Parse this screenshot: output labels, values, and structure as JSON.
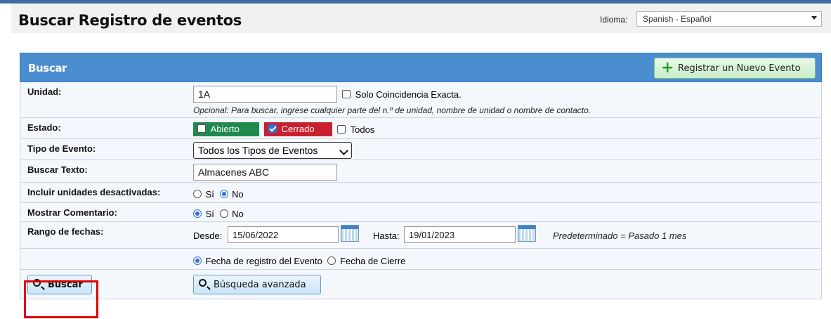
{
  "header": {
    "title": "Buscar Registro de eventos",
    "language_label": "Idioma:",
    "language_value": "Spanish - Español"
  },
  "panel": {
    "title": "Buscar",
    "new_event_button": "Registrar un Nuevo Evento"
  },
  "form": {
    "unit": {
      "label": "Unidad:",
      "value": "1A",
      "exact_match_label": "Solo Coincidencia Exacta.",
      "exact_match_checked": false,
      "hint": "Opcional: Para buscar, ingrese cualquier parte del n.º de unidad, nombre de unidad o nombre de contacto."
    },
    "status": {
      "label": "Estado:",
      "open_label": "Abierto",
      "open_checked": false,
      "closed_label": "Cerrado",
      "closed_checked": true,
      "all_label": "Todos",
      "all_checked": false
    },
    "event_type": {
      "label": "Tipo de Evento:",
      "value": "Todos los Tipos de Eventos"
    },
    "search_text": {
      "label": "Buscar Texto:",
      "value": "Almacenes ABC"
    },
    "include_inactive": {
      "label": "Incluir unidades desactivadas:",
      "yes_label": "Sí",
      "no_label": "No",
      "selected": "No"
    },
    "show_comment": {
      "label": "Mostrar Comentario:",
      "yes_label": "Sí",
      "no_label": "No",
      "selected": "Sí"
    },
    "date_range": {
      "label": "Rango de fechas:",
      "from_label": "Desde:",
      "from_value": "15/06/2022",
      "to_label": "Hasta:",
      "to_value": "19/01/2023",
      "default_hint": "Predeterminado = Pasado 1 mes",
      "option_event_date": "Fecha de registro del Evento",
      "option_close_date": "Fecha de Cierre",
      "selected": "Fecha de registro del Evento"
    }
  },
  "actions": {
    "search_button": "Buscar",
    "advanced_search_button": "Búsqueda avanzada"
  },
  "colors": {
    "panel_header": "#4b8ecf",
    "open_chip": "#1e8a4c",
    "closed_chip": "#c8202f",
    "highlight": "#e00000"
  }
}
